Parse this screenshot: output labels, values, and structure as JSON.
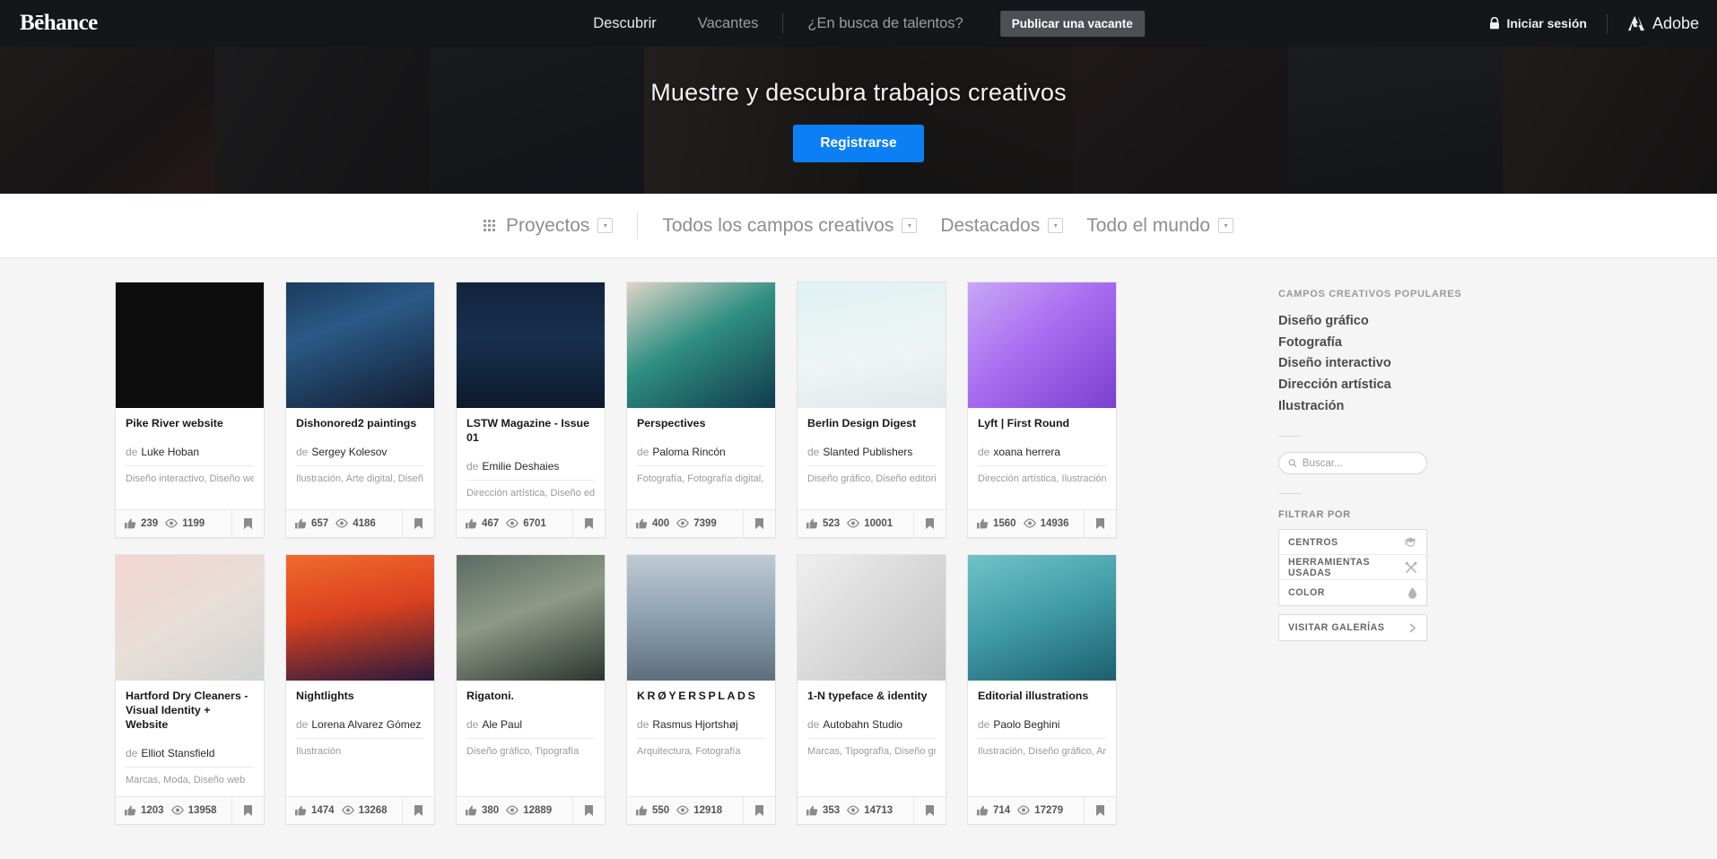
{
  "nav": {
    "logo": "Bēhance",
    "links": [
      {
        "label": "Descubrir",
        "dim": false
      },
      {
        "label": "Vacantes",
        "dim": true
      },
      {
        "label": "¿En busca de talentos?",
        "dim": true
      }
    ],
    "cta_label": "Publicar una vacante",
    "signin_label": "Iniciar sesión",
    "adobe_label": "Adobe",
    "lock_icon": "lock-icon",
    "adobe_icon": "adobe-logo-icon"
  },
  "hero": {
    "title": "Muestre y descubra trabajos creativos",
    "button_label": "Registrarse",
    "button_color": "#0d7ff5"
  },
  "filterbar": {
    "grid_icon": "grid-icon",
    "items": [
      {
        "label": "Proyectos",
        "caret": "▾"
      },
      {
        "label": "Todos los campos creativos",
        "caret": "▾"
      },
      {
        "label": "Destacados",
        "caret": "▾"
      },
      {
        "label": "Todo el mundo",
        "caret": "▾"
      }
    ]
  },
  "cards": [
    {
      "title": "Pike River website",
      "de": "de",
      "owner": "Luke Hoban",
      "fields": "Diseño interactivo, Diseño we...",
      "likes": "239",
      "views": "1199",
      "thumb": "pike-river-website-thumbnail"
    },
    {
      "title": "Dishonored2 paintings",
      "de": "de",
      "owner": "Sergey Kolesov",
      "fields": "Ilustración, Arte digital, Diseñ...",
      "likes": "657",
      "views": "4186",
      "thumb": "dishonored2-paintings-thumbnail"
    },
    {
      "title": "LSTW Magazine - Issue 01",
      "de": "de",
      "owner": "Emilie Deshaies",
      "fields": "Dirección artística, Diseño edi...",
      "likes": "467",
      "views": "6701",
      "thumb": "lstw-magazine-thumbnail"
    },
    {
      "title": "Perspectives",
      "de": "de",
      "owner": "Paloma Rincón",
      "fields": "Fotografía, Fotografía digital, ...",
      "likes": "400",
      "views": "7399",
      "thumb": "perspectives-thumbnail"
    },
    {
      "title": "Berlin Design Digest",
      "de": "de",
      "owner": "Slanted Publishers",
      "fields": "Diseño gráfico, Diseño editori...",
      "likes": "523",
      "views": "10001",
      "thumb": "berlin-design-digest-thumbnail"
    },
    {
      "title": "Lyft | First Round",
      "de": "de",
      "owner": "xoana herrera",
      "fields": "Dirección artística, Ilustración,...",
      "likes": "1560",
      "views": "14936",
      "thumb": "lyft-first-round-thumbnail"
    },
    {
      "title": "Hartford Dry Cleaners - Visual Identity + Website",
      "de": "de",
      "owner": "Elliot Stansfield",
      "fields": "Marcas, Moda, Diseño web",
      "likes": "1203",
      "views": "13958",
      "thumb": "hartford-dry-cleaners-thumbnail"
    },
    {
      "title": "Nightlights",
      "de": "de",
      "owner": "Lorena Alvarez Gómez",
      "fields": "Ilustración",
      "likes": "1474",
      "views": "13268",
      "thumb": "nightlights-thumbnail"
    },
    {
      "title": "Rigatoni.",
      "de": "de",
      "owner": "Ale Paul",
      "fields": "Diseño gráfico, Tipografía",
      "likes": "380",
      "views": "12889",
      "thumb": "rigatoni-thumbnail"
    },
    {
      "title": "KRØYERSPLADS",
      "de": "de",
      "owner": "Rasmus Hjortshøj",
      "fields": "Arquitectura, Fotografía",
      "likes": "550",
      "views": "12918",
      "thumb": "kroyersplads-thumbnail",
      "spaced": true
    },
    {
      "title": "1-N typeface & identity",
      "de": "de",
      "owner": "Autobahn Studio",
      "fields": "Marcas, Tipografía, Diseño gr...",
      "likes": "353",
      "views": "14713",
      "thumb": "1n-typeface-identity-thumbnail"
    },
    {
      "title": "Editorial illustrations",
      "de": "de",
      "owner": "Paolo Beghini",
      "fields": "Ilustración, Diseño gráfico, Art...",
      "likes": "714",
      "views": "17279",
      "thumb": "editorial-illustrations-thumbnail"
    }
  ],
  "sidebar": {
    "popular_heading": "CAMPOS CREATIVOS POPULARES",
    "fields": [
      "Diseño gráfico",
      "Fotografía",
      "Diseño interactivo",
      "Dirección artística",
      "Ilustración"
    ],
    "search_placeholder": "Buscar...",
    "search_value": "",
    "search_icon": "search-icon",
    "filter_heading": "FILTRAR POR",
    "filters": [
      {
        "label": "CENTROS",
        "icon": "graduation-cap-icon"
      },
      {
        "label": "HERRAMIENTAS USADAS",
        "icon": "tools-icon"
      },
      {
        "label": "COLOR",
        "icon": "droplet-icon"
      }
    ],
    "galleries_label": "VISITAR GALERÍAS",
    "galleries_icon": "chevron-right-icon"
  }
}
